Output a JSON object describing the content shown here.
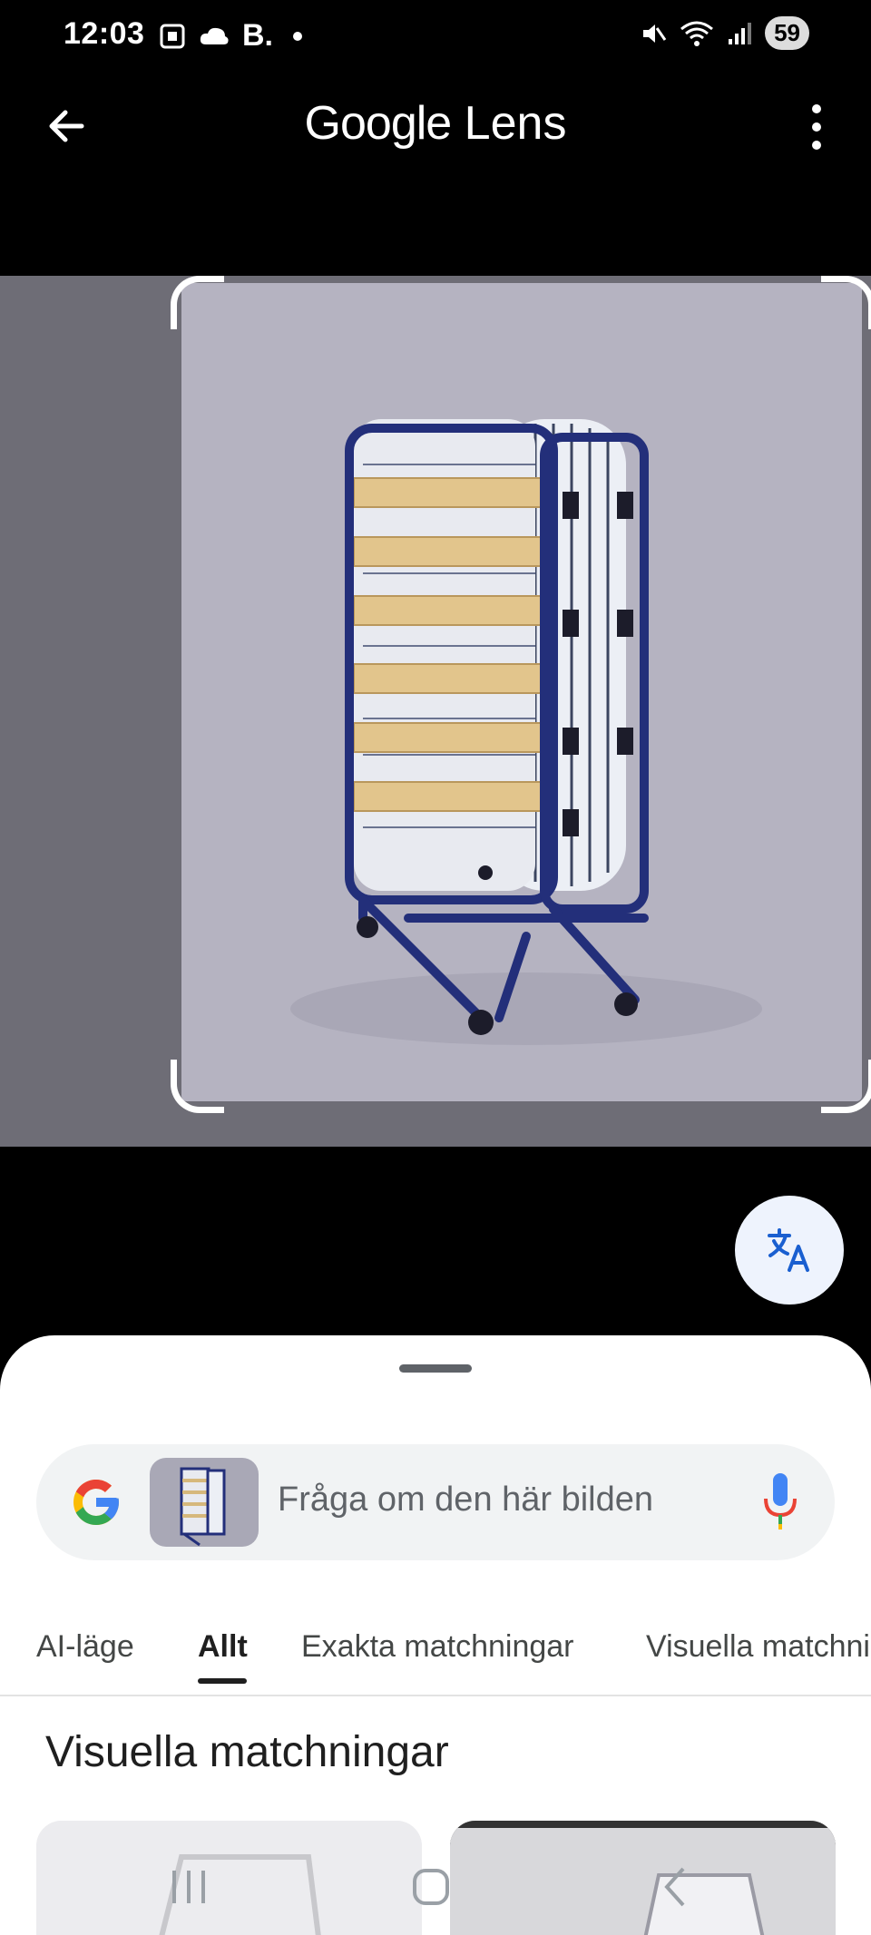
{
  "status_bar": {
    "time": "12:03",
    "carrier_letter": "B.",
    "battery": "59"
  },
  "app_bar": {
    "title_google": "Google",
    "title_lens": " Lens"
  },
  "search": {
    "placeholder": "Fråga om den här bilden"
  },
  "tabs": [
    {
      "label": "AI-läge"
    },
    {
      "label": "Allt"
    },
    {
      "label": "Exakta matchningar"
    },
    {
      "label": "Visuella matchningar"
    }
  ],
  "active_tab": "Allt",
  "section_title": "Visuella matchningar",
  "colors": {
    "accent_blue": "#1a5fd0",
    "google_blue": "#4285F4",
    "google_red": "#EA4335",
    "google_yellow": "#FBBC05",
    "google_green": "#34A853"
  }
}
